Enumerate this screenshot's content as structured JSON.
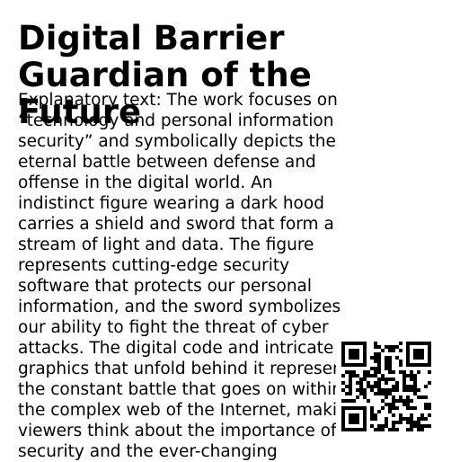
{
  "title_lines": [
    "Digital Barrier",
    "Guardian of the",
    "Future"
  ],
  "body_lines": [
    "Explanatory text: The work focuses on",
    "“technology and personal information",
    "security” and symbolically depicts the",
    "eternal battle between defense and",
    "offense in the digital world. An",
    "indistinct figure wearing a dark hood",
    "carries a shield and sword that form a",
    "stream of light and data. The figure",
    "represents cutting-edge security",
    "software that protects our personal",
    "information, and the sword symbolizes",
    "our ability to fight the threat of cyber",
    "attacks. The digital code and intricate",
    "graphics that unfold behind it represent",
    "the constant battle that goes on within",
    "the complex web of the Internet, making",
    "viewers think about the importance of",
    "security and the ever-changing"
  ],
  "qr_code": {
    "color": "#000000",
    "background": "#ffffff"
  }
}
